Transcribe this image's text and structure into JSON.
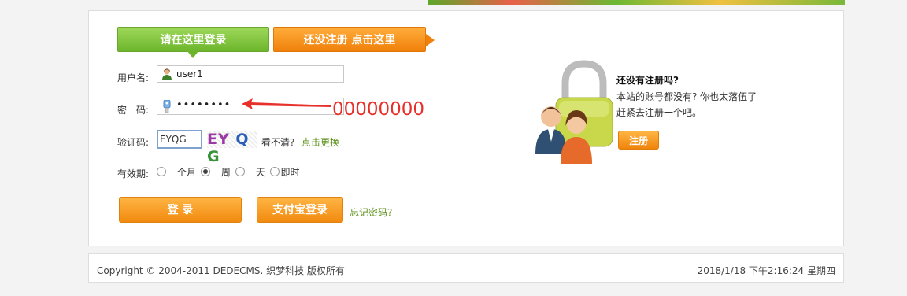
{
  "tabs": {
    "login": "请在这里登录",
    "register": "还没注册 点击这里"
  },
  "form": {
    "username_label": "用户名:",
    "username_value": "user1",
    "password_label": "密　码:",
    "password_mask": "••••••••",
    "captcha_label": "验证码:",
    "captcha_value": "EYQG",
    "captcha_image_text": [
      "EY",
      "Q",
      "G"
    ],
    "captcha_hint": "看不清?",
    "captcha_refresh": "点击更换",
    "validity_label": "有效期:",
    "validity_options": [
      "一个月",
      "一周",
      "一天",
      "即时"
    ],
    "validity_selected": "一周"
  },
  "buttons": {
    "login": "登 录",
    "alipay": "支付宝登录",
    "forgot": "忘记密码?"
  },
  "annotation": "00000000",
  "side": {
    "title": "还没有注册吗?",
    "line1": "本站的账号都没有? 你也太落伍了",
    "line2": "赶紧去注册一个吧。",
    "register_button": "注册"
  },
  "footer": {
    "copyright": "Copyright © 2004-2011 DEDECMS. 织梦科技 版权所有",
    "datetime": "2018/1/18 下午2:16:24 星期四"
  },
  "colors": {
    "accent_orange": "#f0800a",
    "accent_green": "#6cb52b",
    "annotation_red": "#e8302a"
  }
}
